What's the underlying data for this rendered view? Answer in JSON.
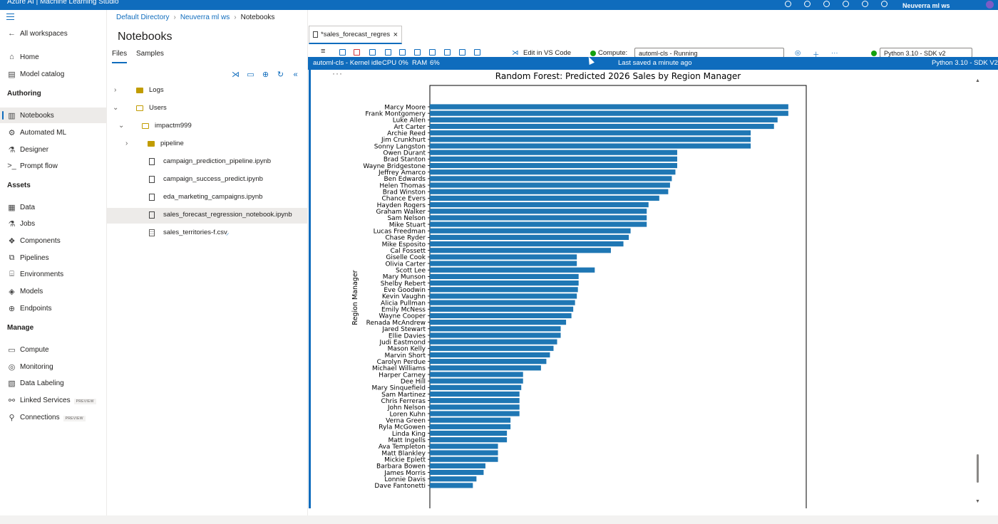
{
  "topbar": {
    "brand": "Azure AI | Machine Learning Studio",
    "workspace": "Neuverra ml ws"
  },
  "nav": {
    "all_workspaces": "All workspaces",
    "home": "Home",
    "model_catalog": "Model catalog",
    "authoring": "Authoring",
    "notebooks": "Notebooks",
    "automated_ml": "Automated ML",
    "designer": "Designer",
    "prompt_flow": "Prompt flow",
    "assets": "Assets",
    "data": "Data",
    "jobs": "Jobs",
    "components": "Components",
    "pipelines": "Pipelines",
    "environments": "Environments",
    "models": "Models",
    "endpoints": "Endpoints",
    "manage": "Manage",
    "compute": "Compute",
    "monitoring": "Monitoring",
    "data_labeling": "Data Labeling",
    "linked_services": "Linked Services",
    "connections": "Connections",
    "preview": "PREVIEW"
  },
  "breadcrumb": {
    "directory": "Default Directory",
    "workspace": "Neuverra ml ws",
    "current": "Notebooks"
  },
  "files_panel": {
    "title": "Notebooks",
    "tab_files": "Files",
    "tab_samples": "Samples",
    "tree": {
      "logs": "Logs",
      "users": "Users",
      "user": "impactm999",
      "pipeline": "pipeline",
      "f1": "campaign_prediction_pipeline.ipynb",
      "f2": "campaign_success_predict.ipynb",
      "f3": "eda_marketing_campaigns.ipynb",
      "f4": "sales_forecast_regression_notebook.ipynb",
      "f5": "sales_territories-f.csv"
    }
  },
  "editor": {
    "tab_title": "*sales_forecast_regres",
    "edit_in_vscode": "Edit in VS Code",
    "compute_label": "Compute:",
    "compute_value": "automl-cls  -  Running",
    "kernel": "Python 3.10 - SDK v2",
    "status": {
      "kernel": "automl-cls - Kernel idle",
      "cpu": "CPU",
      "cpu_val": "0%",
      "ram": "RAM",
      "ram_val": "6%",
      "saved": "Last saved a minute ago",
      "python": "Python 3.10 - SDK V2"
    }
  },
  "chart_data": {
    "type": "bar",
    "orientation": "horizontal",
    "title": "Random Forest: Predicted 2026 Sales by Region Manager",
    "xlabel": "",
    "ylabel": "Region Manager",
    "color": "#1f77b4",
    "xlim": [
      0,
      105
    ],
    "categories": [
      "Marcy Moore",
      "Frank Montgomery",
      "Luke Allen",
      "Art Carter",
      "Archie Reed",
      "Jim Crunkhurt",
      "Sonny Langston",
      "Owen Durant",
      "Brad Stanton",
      "Wayne Bridgestone",
      "Jeffrey Amarco",
      "Ben Edwards",
      "Helen Thomas",
      "Brad Winston",
      "Chance Evers",
      "Hayden Rogers",
      "Graham Walker",
      "Sam Nelson",
      "Mike Stuart",
      "Lucas Freedman",
      "Chase Ryder",
      "Mike Esposito",
      "Cal Fossett",
      "Giselle Cook",
      "Olivia Carter",
      "Scott Lee",
      "Mary Munson",
      "Shelby Rebert",
      "Eve Goodwin",
      "Kevin Vaughn",
      "Alicia Pullman",
      "Emily McNess",
      "Wayne Cooper",
      "Renada McAndrew",
      "Jared Stewart",
      "Ellie Davies",
      "Judi Eastmond",
      "Mason Kelly",
      "Marvin Short",
      "Carolyn Perdue",
      "Michael Williams",
      "Harper Carney",
      "Dee Hill",
      "Mary Sinquefield",
      "Sam Martinez",
      "Chris Ferreras",
      "John Nelson",
      "Loren Kuhn",
      "Verna Green",
      "Ryla McGowen",
      "Linda King",
      "Matt Ingells",
      "Ava Templeton",
      "Matt Blankley",
      "Mickie Eplett",
      "Barbara Bowen",
      "James Morris",
      "Lonnie Davis",
      "Dave Fantonetti"
    ],
    "values": [
      100,
      100,
      97,
      96,
      89.5,
      89.5,
      89.5,
      69,
      69,
      69,
      68.5,
      67.5,
      67,
      66.5,
      64,
      61,
      60.5,
      60.5,
      60.5,
      56,
      55.5,
      54,
      50.5,
      41,
      41,
      46,
      41.5,
      41.5,
      41.3,
      41,
      40.5,
      40,
      39.5,
      38,
      36.5,
      36.5,
      35.5,
      34.5,
      33.5,
      32.5,
      31,
      26,
      26,
      25.5,
      25,
      25,
      25,
      25,
      22.5,
      22.5,
      21.5,
      21.5,
      19,
      19,
      19,
      15.5,
      15,
      13,
      12
    ]
  }
}
